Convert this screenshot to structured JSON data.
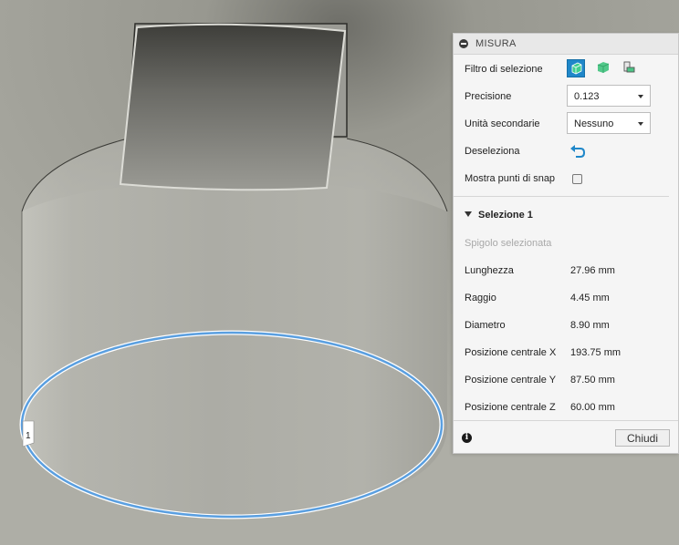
{
  "panel": {
    "title": "MISURA",
    "rows": {
      "filter_label": "Filtro di selezione",
      "precision_label": "Precisione",
      "precision_value": "0.123",
      "secondary_units_label": "Unità secondarie",
      "secondary_units_value": "Nessuno",
      "deselect_label": "Deseleziona",
      "snap_label": "Mostra punti di snap",
      "snap_checked": false
    },
    "selection": {
      "header": "Selezione 1",
      "type": "Spigolo selezionata",
      "measurements": [
        {
          "label": "Lunghezza",
          "value": "27.96 mm"
        },
        {
          "label": "Raggio",
          "value": "4.45 mm"
        },
        {
          "label": "Diametro",
          "value": "8.90 mm"
        },
        {
          "label": "Posizione centrale X",
          "value": "193.75 mm"
        },
        {
          "label": "Posizione centrale Y",
          "value": "87.50 mm"
        },
        {
          "label": "Posizione centrale Z",
          "value": "60.00 mm"
        }
      ]
    },
    "close_label": "Chiudi",
    "icons": [
      "collapse-icon",
      "select-body-icon",
      "select-face-icon",
      "select-edge-icon",
      "undo-icon",
      "info-icon"
    ]
  },
  "viewport": {
    "selection_marker": "1"
  },
  "colors": {
    "accent": "#1f87c9",
    "selection_edge": "#5a9fe0",
    "background": "#a6a69e"
  }
}
